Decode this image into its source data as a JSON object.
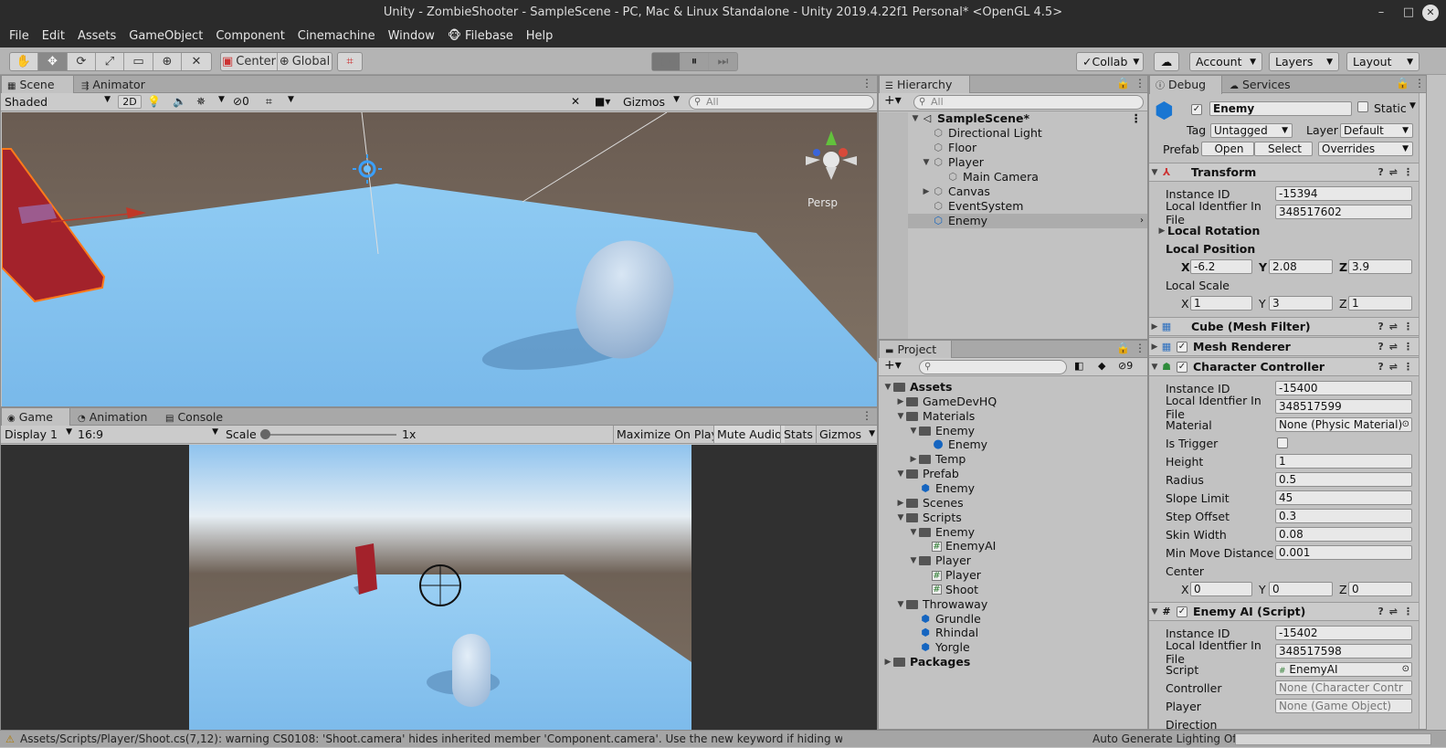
{
  "window": {
    "title": "Unity - ZombieShooter - SampleScene - PC, Mac & Linux Standalone - Unity 2019.4.22f1 Personal* <OpenGL 4.5>",
    "minimize": "–",
    "maximize": "□",
    "close": "✕"
  },
  "menu": [
    "File",
    "Edit",
    "Assets",
    "GameObject",
    "Component",
    "Cinemachine",
    "Window",
    "Filebase",
    "Help"
  ],
  "filebase_icon": "🐵",
  "toolbar": {
    "pivot": "Center",
    "space": "Global",
    "collab": "Collab",
    "account": "Account",
    "layers": "Layers",
    "layout": "Layout",
    "tool_icons": [
      "✋",
      "✥",
      "⟳",
      "⤢",
      "▭",
      "⊕",
      "✕"
    ],
    "play_icons": [
      "▶",
      "⏸",
      "⏭"
    ]
  },
  "scene": {
    "tabs": [
      "Scene",
      "Animator"
    ],
    "shading": "Shaded",
    "mode_2d": "2D",
    "hidden_count": "0",
    "gizmos": "Gizmos",
    "search_placeholder": "All",
    "persp": "Persp"
  },
  "game": {
    "tabs": [
      "Game",
      "Animation",
      "Console"
    ],
    "display": "Display 1",
    "aspect": "16:9",
    "scale_label": "Scale",
    "scale_value": "1x",
    "maximize": "Maximize On Play",
    "mute": "Mute Audio",
    "stats": "Stats",
    "gizmos": "Gizmos"
  },
  "hierarchy": {
    "tab": "Hierarchy",
    "search_placeholder": "All",
    "scene_name": "SampleScene*",
    "items": [
      {
        "label": "Directional Light",
        "depth": 1,
        "arrow": ""
      },
      {
        "label": "Floor",
        "depth": 1,
        "arrow": ""
      },
      {
        "label": "Player",
        "depth": 1,
        "arrow": "▼"
      },
      {
        "label": "Main Camera",
        "depth": 2,
        "arrow": ""
      },
      {
        "label": "Canvas",
        "depth": 1,
        "arrow": "▶"
      },
      {
        "label": "EventSystem",
        "depth": 1,
        "arrow": ""
      },
      {
        "label": "Enemy",
        "depth": 1,
        "arrow": "",
        "selected": true,
        "blue": true
      }
    ]
  },
  "project": {
    "tab": "Project",
    "hidden_count": "9",
    "items": [
      {
        "label": "Assets",
        "depth": 0,
        "arrow": "▼",
        "kind": "folder",
        "bold": true
      },
      {
        "label": "GameDevHQ",
        "depth": 1,
        "arrow": "▶",
        "kind": "folder"
      },
      {
        "label": "Materials",
        "depth": 1,
        "arrow": "▼",
        "kind": "folder"
      },
      {
        "label": "Enemy",
        "depth": 2,
        "arrow": "▼",
        "kind": "folder"
      },
      {
        "label": "Enemy",
        "depth": 3,
        "arrow": "",
        "kind": "material"
      },
      {
        "label": "Temp",
        "depth": 2,
        "arrow": "▶",
        "kind": "folder"
      },
      {
        "label": "Prefab",
        "depth": 1,
        "arrow": "▼",
        "kind": "folder"
      },
      {
        "label": "Enemy",
        "depth": 2,
        "arrow": "",
        "kind": "prefab"
      },
      {
        "label": "Scenes",
        "depth": 1,
        "arrow": "▶",
        "kind": "folder"
      },
      {
        "label": "Scripts",
        "depth": 1,
        "arrow": "▼",
        "kind": "folder"
      },
      {
        "label": "Enemy",
        "depth": 2,
        "arrow": "▼",
        "kind": "folder"
      },
      {
        "label": "EnemyAI",
        "depth": 3,
        "arrow": "",
        "kind": "script"
      },
      {
        "label": "Player",
        "depth": 2,
        "arrow": "▼",
        "kind": "folder"
      },
      {
        "label": "Player",
        "depth": 3,
        "arrow": "",
        "kind": "script"
      },
      {
        "label": "Shoot",
        "depth": 3,
        "arrow": "",
        "kind": "script"
      },
      {
        "label": "Throwaway",
        "depth": 1,
        "arrow": "▼",
        "kind": "folder"
      },
      {
        "label": "Grundle",
        "depth": 2,
        "arrow": "",
        "kind": "prefab"
      },
      {
        "label": "Rhindal",
        "depth": 2,
        "arrow": "",
        "kind": "prefab"
      },
      {
        "label": "Yorgle",
        "depth": 2,
        "arrow": "",
        "kind": "prefab"
      },
      {
        "label": "Packages",
        "depth": 0,
        "arrow": "▶",
        "kind": "folder",
        "bold": true
      }
    ]
  },
  "inspector": {
    "tabs": [
      "Debug",
      "Services"
    ],
    "object_name": "Enemy",
    "static": "Static",
    "tag_label": "Tag",
    "tag": "Untagged",
    "layer_label": "Layer",
    "layer": "Default",
    "prefab_label": "Prefab",
    "open": "Open",
    "select": "Select",
    "overrides": "Overrides",
    "transform": {
      "title": "Transform",
      "instance_id_label": "Instance ID",
      "instance_id": "-15394",
      "local_id_label": "Local Identfier In File",
      "local_id": "348517602",
      "rotation_label": "Local Rotation",
      "position_label": "Local Position",
      "pos_x": "-6.2",
      "pos_y": "2.08",
      "pos_z": "3.9",
      "scale_label": "Local Scale",
      "scale_x": "1",
      "scale_y": "3",
      "scale_z": "1"
    },
    "mesh_filter": "Cube (Mesh Filter)",
    "mesh_renderer": "Mesh Renderer",
    "character_controller": {
      "title": "Character Controller",
      "instance_id": "-15400",
      "local_id": "348517599",
      "material_label": "Material",
      "material": "None (Physic Material)",
      "trigger_label": "Is Trigger",
      "height_label": "Height",
      "height": "1",
      "radius_label": "Radius",
      "radius": "0.5",
      "slope_label": "Slope Limit",
      "slope": "45",
      "step_label": "Step Offset",
      "step": "0.3",
      "skin_label": "Skin Width",
      "skin": "0.08",
      "minmove_label": "Min Move Distance",
      "minmove": "0.001",
      "center_label": "Center",
      "cx": "0",
      "cy": "0",
      "cz": "0"
    },
    "enemy_ai": {
      "title": "Enemy AI (Script)",
      "instance_id": "-15402",
      "local_id": "348517598",
      "script_label": "Script",
      "script": "EnemyAI",
      "controller_label": "Controller",
      "controller": "None (Character Contr",
      "player_label": "Player",
      "player": "None (Game Object)",
      "direction_label": "Direction"
    },
    "axis_x": "X",
    "axis_y": "Y",
    "axis_z": "Z"
  },
  "status": {
    "message": "Assets/Scripts/Player/Shoot.cs(7,12): warning CS0108: 'Shoot.camera' hides inherited member 'Component.camera'. Use the new keyword if hiding was intended.",
    "lighting": "Auto Generate Lighting Off"
  },
  "colors": {
    "selection": "#3d6ec9",
    "sky": "#8fc3ee",
    "floor": "#7ab8ec",
    "enemy_red": "#a3222b"
  }
}
